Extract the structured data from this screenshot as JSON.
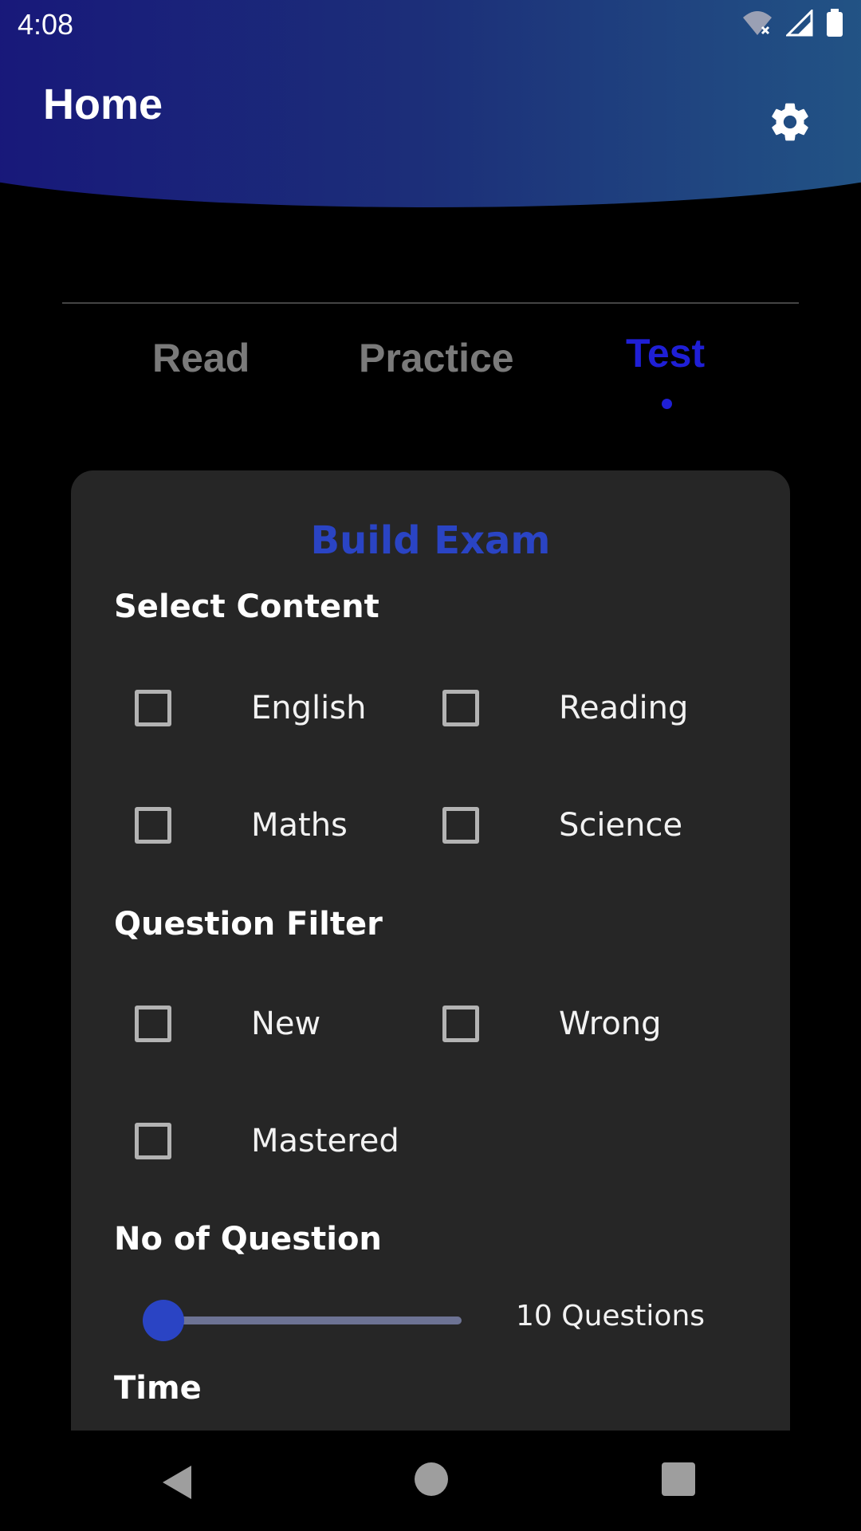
{
  "status_bar": {
    "time": "4:08",
    "icons": [
      "wifi-off-icon",
      "cell-signal-icon",
      "battery-icon"
    ]
  },
  "header": {
    "title": "Home",
    "settings_icon": "gear-icon",
    "gradient": [
      "#17147a",
      "#235a87"
    ]
  },
  "tabs": [
    {
      "label": "Read",
      "active": false
    },
    {
      "label": "Practice",
      "active": false
    },
    {
      "label": "Test",
      "active": true
    }
  ],
  "colors": {
    "accent": "#1f1fd6",
    "card_title": "#2a44c4",
    "card_bg": "#262626",
    "inactive_tab": "#7a7a7a"
  },
  "card": {
    "title": "Build Exam",
    "select_content": {
      "heading": "Select Content",
      "options": [
        {
          "label": "English",
          "checked": false
        },
        {
          "label": "Reading",
          "checked": false
        },
        {
          "label": "Maths",
          "checked": false
        },
        {
          "label": "Science",
          "checked": false
        }
      ]
    },
    "question_filter": {
      "heading": "Question Filter",
      "options": [
        {
          "label": "New",
          "checked": false
        },
        {
          "label": "Wrong",
          "checked": false
        },
        {
          "label": "Mastered",
          "checked": false
        }
      ]
    },
    "no_of_question": {
      "heading": "No of Question",
      "value_label": "10 Questions",
      "slider_fraction": 0
    },
    "time": {
      "heading": "Time"
    }
  },
  "navbar": {
    "icons": [
      "back-icon",
      "home-icon",
      "recents-icon"
    ]
  }
}
